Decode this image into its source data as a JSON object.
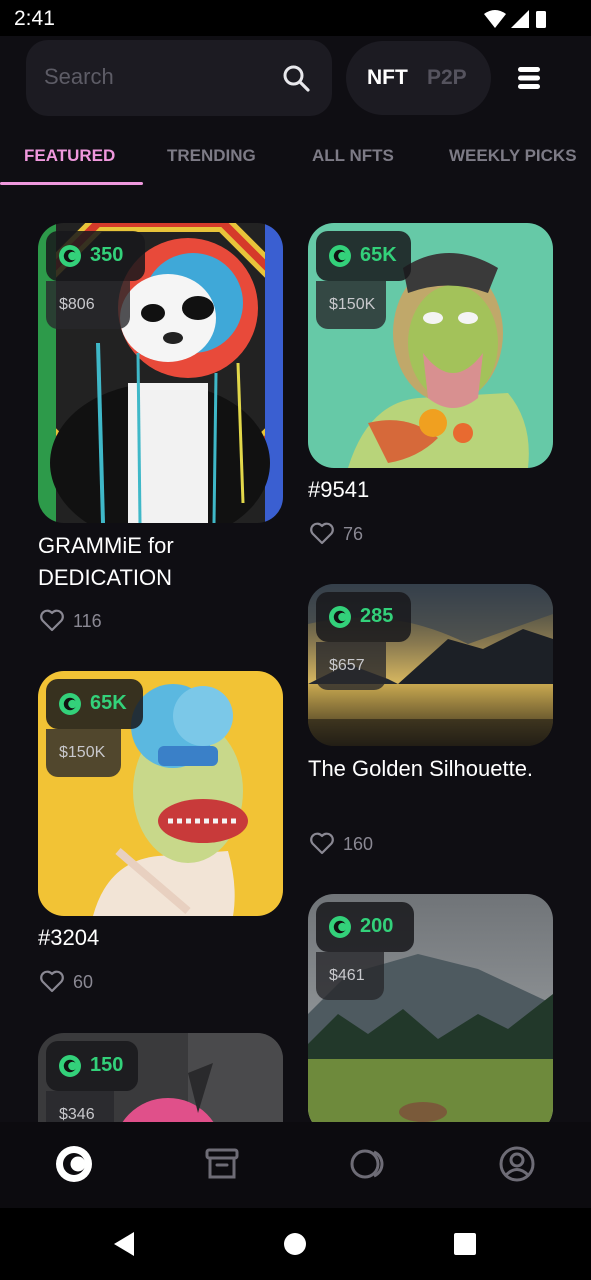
{
  "status": {
    "time": "2:41"
  },
  "search": {
    "placeholder": "Search"
  },
  "market_toggle": {
    "nft": "NFT",
    "p2p": "P2P",
    "selected": "NFT"
  },
  "tabs": [
    {
      "label": "FEATURED",
      "active": true
    },
    {
      "label": "TRENDING",
      "active": false
    },
    {
      "label": "ALL NFTS",
      "active": false
    },
    {
      "label": "WEEKLY PICKS",
      "active": false
    }
  ],
  "cards": [
    {
      "price_coin": "350",
      "price_usd": "$806",
      "title": "GRAMMiE for DEDICATION",
      "likes": "116"
    },
    {
      "price_coin": "65K",
      "price_usd": "$150K",
      "title": "#9541",
      "likes": "76"
    },
    {
      "price_coin": "65K",
      "price_usd": "$150K",
      "title": "#3204",
      "likes": "60"
    },
    {
      "price_coin": "285",
      "price_usd": "$657",
      "title": "The Golden Silhouette.",
      "likes": "160"
    },
    {
      "price_coin": "150",
      "price_usd": "$346"
    },
    {
      "price_coin": "200",
      "price_usd": "$461"
    }
  ],
  "bottom_nav": [
    {
      "icon": "coin-icon",
      "active": true
    },
    {
      "icon": "archive-icon",
      "active": false
    },
    {
      "icon": "circles-icon",
      "active": false
    },
    {
      "icon": "profile-icon",
      "active": false
    }
  ],
  "colors": {
    "accent": "#ef98dd",
    "coin_green": "#33d17a",
    "background": "#0f0e13"
  }
}
